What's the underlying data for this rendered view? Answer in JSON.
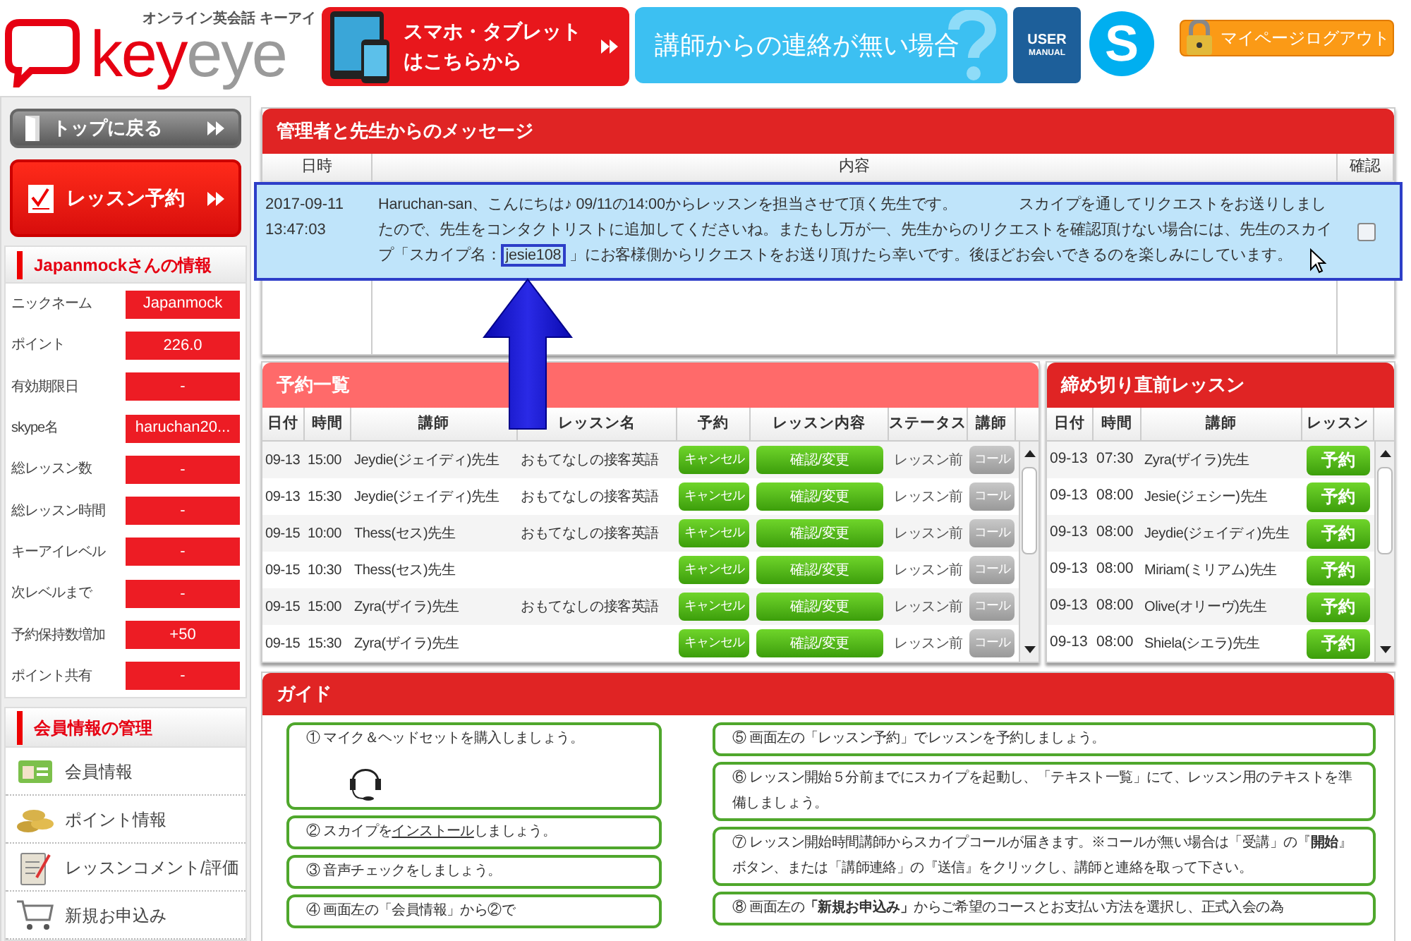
{
  "header": {
    "logo": {
      "tagline": "オンライン英会話 キーアイ",
      "part1": "key",
      "part2": "eye"
    },
    "mobile_banner": {
      "line1": "スマホ・タブレット",
      "line2": "はこちらから"
    },
    "contact_banner": {
      "label": "講師からの連絡が無い場合"
    },
    "manual": {
      "line1": "USER",
      "line2": "MANUAL"
    },
    "skype": {
      "letter": "S"
    },
    "logout": {
      "label": "マイページログアウト"
    }
  },
  "sidebar": {
    "back_button": "トップに戻る",
    "reserve_button": "レッスン予約",
    "info_title": "Japanmockさんの情報",
    "info": [
      {
        "label": "ニックネーム",
        "value": "Japanmock"
      },
      {
        "label": "ポイント",
        "value": "226.0"
      },
      {
        "label": "有効期限日",
        "value": "-"
      },
      {
        "label": "skype名",
        "value": "haruchan20..."
      },
      {
        "label": "総レッスン数",
        "value": "-"
      },
      {
        "label": "総レッスン時間",
        "value": "-"
      },
      {
        "label": "キーアイレベル",
        "value": "-"
      },
      {
        "label": "次レベルまで",
        "value": "-"
      },
      {
        "label": "予約保持数増加",
        "value": "+50"
      },
      {
        "label": "ポイント共有",
        "value": "-"
      }
    ],
    "manage_title": "会員情報の管理",
    "menu": [
      {
        "kind": "card",
        "label": "会員情報"
      },
      {
        "kind": "coins",
        "label": "ポイント情報"
      },
      {
        "kind": "clipboard",
        "label": "レッスンコメント/評価"
      },
      {
        "kind": "cart",
        "label": "新規お申込み"
      }
    ]
  },
  "messages": {
    "title": "管理者と先生からのメッセージ",
    "columns": [
      "日時",
      "内容",
      "確認"
    ],
    "rows": [
      {
        "selected": true,
        "date": "2017-09-11",
        "time": "13:47:03",
        "before": "Haruchan-san、こんにちは♪ 09/11の14:00からレッスンを担当させて頂く先生です。　　　　スカイプを通してリクエストをお送りしましたので、先生をコンタクトリストに追加してくださいね。またもし万が一、先生からのリクエストを確認頂けない場合には、先生のスカイプ「スカイプ名：",
        "highlight": "jesie108",
        "after": " 」にお客様側からリクエストをお送り頂けたら幸いです。後ほどお会いできるのを楽しみにしています。",
        "checked": false
      }
    ]
  },
  "reservations": {
    "title": "予約一覧",
    "columns": [
      "日付",
      "時間",
      "講師",
      "レッスン名",
      "予約",
      "レッスン内容",
      "ステータス",
      "講師"
    ],
    "rows": [
      {
        "date": "09-13",
        "time": "15:00",
        "teacher": "Jeydie(ジェイディ)先生",
        "lesson": "おもてなしの接客英語",
        "cancel": "キャンセル",
        "confirm": "確認/変更",
        "status": "レッスン前",
        "call": "コール",
        "call_disabled": true
      },
      {
        "date": "09-13",
        "time": "15:30",
        "teacher": "Jeydie(ジェイディ)先生",
        "lesson": "おもてなしの接客英語",
        "cancel": "キャンセル",
        "confirm": "確認/変更",
        "status": "レッスン前",
        "call": "コール",
        "call_disabled": true
      },
      {
        "date": "09-15",
        "time": "10:00",
        "teacher": "Thess(セス)先生",
        "lesson": "おもてなしの接客英語",
        "cancel": "キャンセル",
        "confirm": "確認/変更",
        "status": "レッスン前",
        "call": "コール",
        "call_disabled": true
      },
      {
        "date": "09-15",
        "time": "10:30",
        "teacher": "Thess(セス)先生",
        "cancel": "キャンセル",
        "confirm": "確認/変更",
        "status": "レッスン前",
        "call": "コール",
        "call_disabled": true
      },
      {
        "date": "09-15",
        "time": "15:00",
        "teacher": "Zyra(ザイラ)先生",
        "lesson": "おもてなしの接客英語",
        "cancel": "キャンセル",
        "confirm": "確認/変更",
        "status": "レッスン前",
        "call": "コール",
        "call_disabled": true
      },
      {
        "date": "09-15",
        "time": "15:30",
        "teacher": "Zyra(ザイラ)先生",
        "cancel": "キャンセル",
        "confirm": "確認/変更",
        "status": "レッスン前",
        "call": "コール",
        "call_disabled": true
      }
    ]
  },
  "deadline": {
    "title": "締め切り直前レッスン",
    "columns": [
      "日付",
      "時間",
      "講師",
      "レッスン"
    ],
    "rows": [
      {
        "date": "09-13",
        "time": "07:30",
        "teacher": "Zyra(ザイラ)先生",
        "button": "予約"
      },
      {
        "date": "09-13",
        "time": "08:00",
        "teacher": "Jesie(ジェシー)先生",
        "button": "予約"
      },
      {
        "date": "09-13",
        "time": "08:00",
        "teacher": "Jeydie(ジェイディ)先生",
        "button": "予約"
      },
      {
        "date": "09-13",
        "time": "08:00",
        "teacher": "Miriam(ミリアム)先生",
        "button": "予約"
      },
      {
        "date": "09-13",
        "time": "08:00",
        "teacher": "Olive(オリーヴ)先生",
        "button": "予約"
      },
      {
        "date": "09-13",
        "time": "08:00",
        "teacher": "Shiela(シエラ)先生",
        "button": "予約"
      }
    ]
  },
  "guide": {
    "title": "ガイド",
    "left": [
      {
        "kind": "headset",
        "text": "① マイク＆ヘッドセットを購入しましょう。"
      },
      {
        "kind": "link",
        "text": "② スカイプを",
        "link": "インストール",
        "text_after": "しましょう。"
      },
      {
        "kind": "plain",
        "text": "③ 音声チェックをしましょう。"
      },
      {
        "kind": "plain",
        "text": "④ 画面左の「会員情報」から②で"
      }
    ],
    "right": [
      {
        "kind": "plain",
        "text": "⑤ 画面左の「レッスン予約」でレッスンを予約しましょう。"
      },
      {
        "kind": "plain",
        "text": "⑥ レッスン開始５分前までにスカイプを起動し、「テキスト一覧」にて、レッスン用のテキストを準備しましょう。"
      },
      {
        "kind": "plain",
        "text": "⑦ レッスン開始時間講師からスカイプコールが届きます。※コールが無い場合は「受講」の『**開始**』ボタン、または「講師連絡」の『送信』をクリックし、講師と連絡を取って下さい。"
      },
      {
        "kind": "plain",
        "text": "⑧ 画面左の**「新規お申込み」**からご希望のコースとお支払い方法を選択し、正式入会の為"
      }
    ]
  }
}
